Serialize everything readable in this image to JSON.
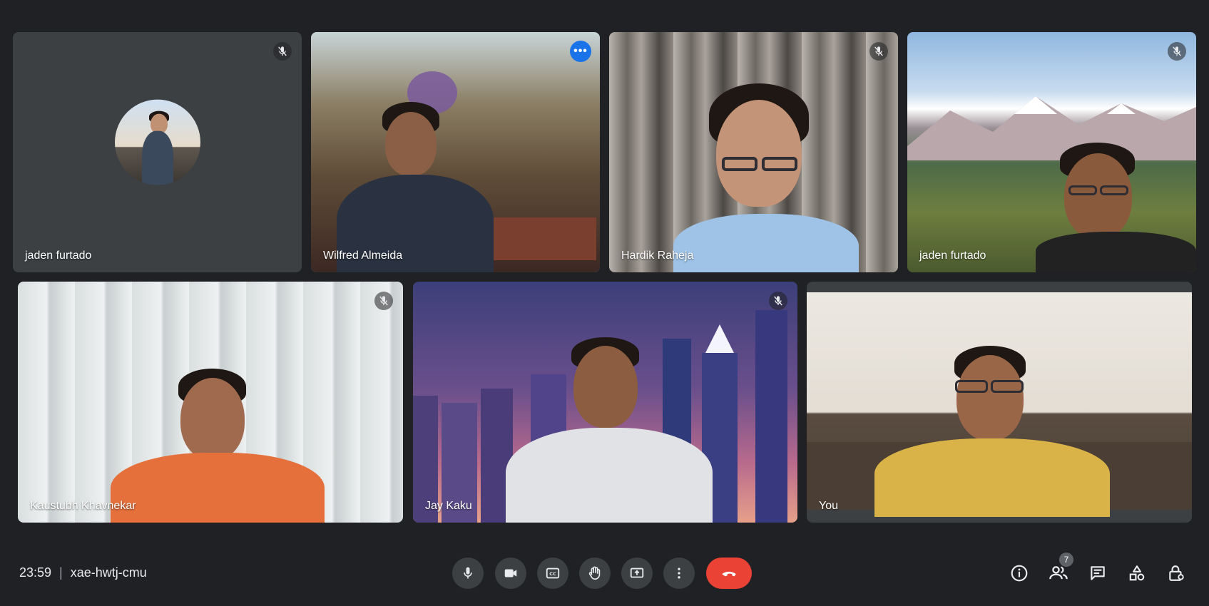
{
  "tiles": [
    {
      "name": "jaden furtado",
      "muted": true,
      "type": "avatar"
    },
    {
      "name": "Wilfred Almeida",
      "muted": false,
      "active": true,
      "type": "video"
    },
    {
      "name": "Hardik Raheja",
      "muted": true,
      "type": "video"
    },
    {
      "name": "jaden furtado",
      "muted": true,
      "type": "video"
    },
    {
      "name": "Kaustubh Khavnekar",
      "muted": true,
      "type": "video"
    },
    {
      "name": "Jay Kaku",
      "muted": true,
      "type": "video"
    },
    {
      "name": "You",
      "muted": false,
      "type": "video"
    }
  ],
  "meeting": {
    "time": "23:59",
    "separator": "|",
    "code": "xae-hwtj-cmu"
  },
  "controls": {
    "mic": "microphone-icon",
    "camera": "camera-icon",
    "captions": "closed-captions-icon",
    "raise_hand": "raise-hand-icon",
    "present": "present-screen-icon",
    "more": "more-options-icon",
    "hangup": "hang-up-icon"
  },
  "right_panel": {
    "participants_count": "7"
  },
  "colors": {
    "background": "#202124",
    "tile_bg": "#3c4043",
    "accent": "#8ab4f8",
    "hangup": "#ea4335"
  }
}
